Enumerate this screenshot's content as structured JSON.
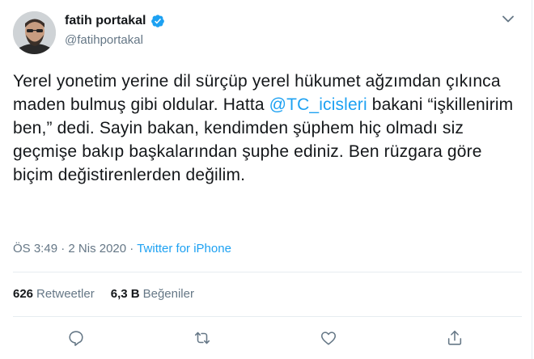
{
  "tweet": {
    "author": {
      "name": "fatih portakal",
      "handle": "@fatihportakal",
      "verified": true
    },
    "text": {
      "part1": "Yerel yonetim yerine dil sürçüp yerel hükumet ağzımdan çıkınca maden bulmuş gibi oldular. Hatta ",
      "mention": "@TC_icisleri",
      "part2": " bakani “işkillenirim ben,” dedi. Sayin bakan, kendimden şüphem hiç olmadı siz geçmişe bakıp başkalarından şuphe ediniz. Ben rüzgara göre biçim değistirenlerden değilim."
    },
    "meta": {
      "time": "ÖS 3:49",
      "separator1": "·",
      "date": "2 Nis 2020",
      "separator2": "·",
      "source": "Twitter for iPhone"
    },
    "stats": {
      "retweets_count": "626",
      "retweets_label": "Retweetler",
      "likes_count": "6,3 B",
      "likes_label": "Beğeniler"
    }
  },
  "colors": {
    "accent": "#1da1f2",
    "text": "#14171a",
    "muted": "#657786",
    "border": "#e6ecf0"
  },
  "icons": [
    "verified-badge-icon",
    "chevron-down-icon",
    "reply-icon",
    "retweet-icon",
    "like-icon",
    "share-icon"
  ]
}
